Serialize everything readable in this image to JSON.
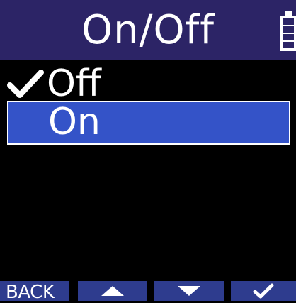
{
  "header": {
    "title": "On/Off",
    "battery_icon": "battery-full-icon"
  },
  "menu": {
    "items": [
      {
        "label": "Off",
        "checked": true,
        "selected": false
      },
      {
        "label": "On",
        "checked": false,
        "selected": true
      }
    ]
  },
  "footer": {
    "back_label": "BACK",
    "up_icon": "up-arrow-icon",
    "down_icon": "down-arrow-icon",
    "enter_icon": "checkmark-icon"
  },
  "colors": {
    "header_bg": "#2c2466",
    "selected_bg": "#3453c8",
    "footer_button_bg": "#2e3c8e",
    "background": "#000000",
    "text": "#ffffff"
  }
}
